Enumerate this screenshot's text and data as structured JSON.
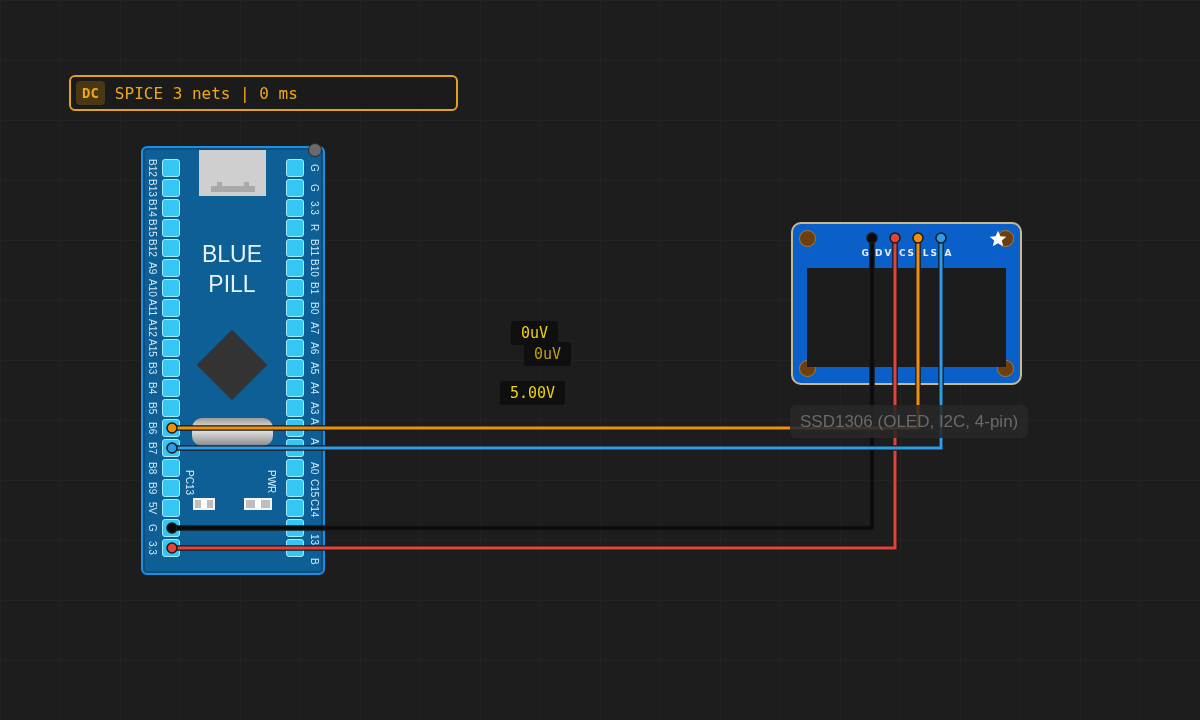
{
  "status": {
    "mode": "DC",
    "text": "SPICE 3 nets | 0 ms"
  },
  "board": {
    "title": [
      "BLUE",
      "PILL"
    ],
    "left_pins": [
      {
        "label": "B12"
      },
      {
        "label": "B13"
      },
      {
        "label": "B14"
      },
      {
        "label": "B15"
      },
      {
        "label": "B12"
      },
      {
        "label": "A9"
      },
      {
        "label": "A10"
      },
      {
        "label": "A11"
      },
      {
        "label": "A12"
      },
      {
        "label": "A15"
      },
      {
        "label": "B3"
      },
      {
        "label": "B4"
      },
      {
        "label": "B5"
      },
      {
        "label": "B6",
        "color": "#f0900a"
      },
      {
        "label": "B7",
        "color": "#2e9be6"
      },
      {
        "label": "B8"
      },
      {
        "label": "B9"
      },
      {
        "label": "5V"
      },
      {
        "label": "G",
        "color": "#0a0a0a"
      },
      {
        "label": "3.3",
        "color": "#e0443c"
      }
    ],
    "right_pins": [
      "G",
      "G",
      "3.3",
      "R",
      "B11",
      "B10",
      "B1",
      "B0",
      "A7",
      "A6",
      "A5",
      "A4",
      "A3",
      "A",
      "A",
      "A0",
      "C15",
      "C14",
      "13",
      "B"
    ],
    "leds": [
      "PC13",
      "PWR"
    ]
  },
  "display": {
    "pins": [
      {
        "left": "G",
        "right": "D",
        "color": "#0a0a0a"
      },
      {
        "left": "V",
        "right": "C",
        "color": "#e0443c"
      },
      {
        "left": "S",
        "right": "L",
        "color": "#f0900a"
      },
      {
        "left": "S",
        "right": "A",
        "color": "#2e9be6"
      }
    ],
    "caption": "SSD1306 (OLED, I2C, 4-pin)"
  },
  "probes": [
    "0uV",
    "0uV",
    "5.00V"
  ]
}
